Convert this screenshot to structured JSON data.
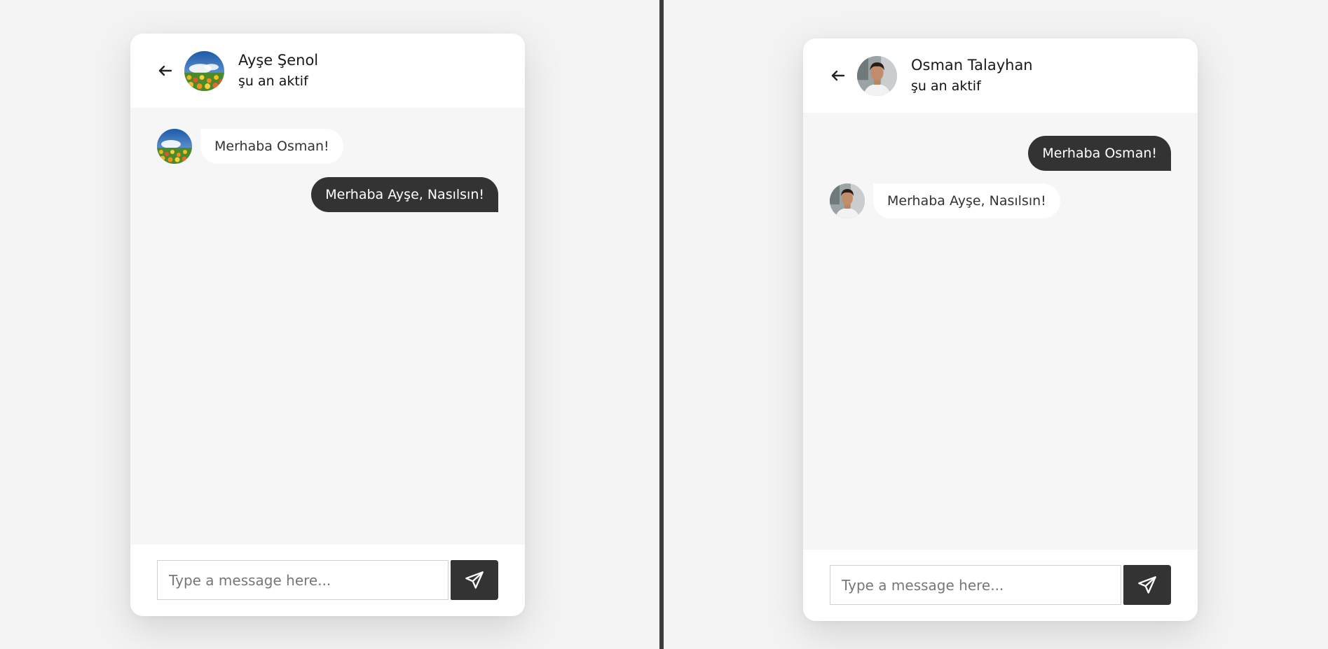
{
  "chats": [
    {
      "header": {
        "name": "Ayşe Şenol",
        "status": "şu an aktif",
        "avatar": "flower-field-avatar"
      },
      "messages": [
        {
          "direction": "in",
          "text": "Merhaba Osman!",
          "avatar": "flower-field-avatar"
        },
        {
          "direction": "out",
          "text": "Merhaba Ayşe, Nasılsın!"
        }
      ],
      "composer": {
        "placeholder": "Type a message here...",
        "send_icon": "paper-plane-icon"
      }
    },
    {
      "header": {
        "name": "Osman Talayhan",
        "status": "şu an aktif",
        "avatar": "person-photo-avatar"
      },
      "messages": [
        {
          "direction": "out",
          "text": "Merhaba Osman!"
        },
        {
          "direction": "in",
          "text": "Merhaba Ayşe, Nasılsın!",
          "avatar": "person-photo-avatar"
        }
      ],
      "composer": {
        "placeholder": "Type a message here...",
        "send_icon": "paper-plane-icon"
      }
    }
  ],
  "colors": {
    "page_background": "#f3f3f3",
    "outgoing_bubble": "#333333",
    "incoming_bubble": "#ffffff",
    "divider": "#3c3c3c"
  }
}
